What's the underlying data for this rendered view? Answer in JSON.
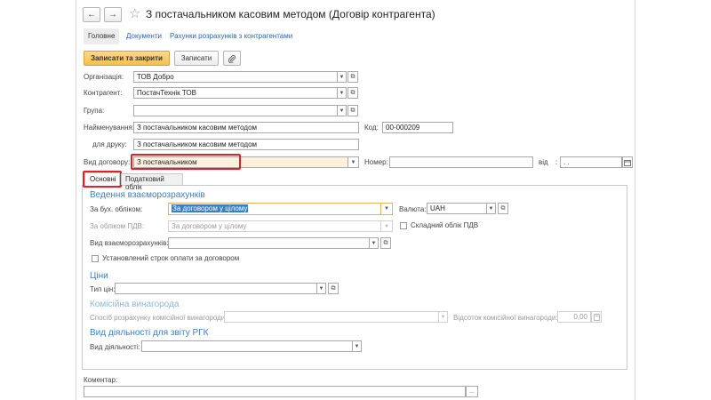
{
  "header": {
    "back": "←",
    "forward": "→",
    "star": "☆",
    "title": "З постачальником касовим методом (Договір контрагента)"
  },
  "nav_tabs": [
    "Головне",
    "Документи",
    "Рахунки розрахунків з контрагентами"
  ],
  "toolbar": {
    "save_close": "Записати та закрити",
    "save": "Записати"
  },
  "form": {
    "org_label": "Організація:",
    "org_value": "ТОВ Добро",
    "contractor_label": "Контрагент:",
    "contractor_value": "ПостачТехнік ТОВ",
    "group_label": "Група:",
    "group_value": "",
    "name_label": "Найменування:",
    "name_value": "З постачальником касовим методом",
    "code_label": "Код:",
    "code_value": "00-000209",
    "print_label": "для друку:",
    "print_value": "З постачальником касовим методом",
    "kind_label": "Вид договору:",
    "kind_value": "З постачальником",
    "number_label": "Номер:",
    "number_value": "",
    "date_label": "від",
    "date_value": ". .",
    "colon": ":"
  },
  "sub_tabs": [
    "Основні",
    "Податковий облік"
  ],
  "settlements": {
    "title": "Ведення взаєморозрахунків",
    "acc_label": "За бух. обліком:",
    "acc_value": "За договором у цілому",
    "currency_label": "Валюта:",
    "currency_value": "UAH",
    "vat_label": "За обліком ПДВ:",
    "vat_value": "За договором у цілому",
    "complex_vat": "Складний облік ПДВ",
    "kind_label": "Вид взаєморозрахунків:",
    "kind_value": "",
    "term_label": "Установлений строк оплати за договором"
  },
  "prices": {
    "title": "Ціни",
    "type_label": "Тип цін:",
    "type_value": ""
  },
  "commission": {
    "title": "Комісійна винагорода",
    "method_label": "Спосіб розрахунку комісійної винагороди:",
    "method_value": "",
    "percent_label": "Відсоток комісійної винагороди:",
    "percent_value": "0,00"
  },
  "activity": {
    "title": "Вид діяльності для звіту РГК",
    "kind_label": "Вид діяльності:",
    "kind_value": ""
  },
  "comment": {
    "label": "Коментар:",
    "value": "",
    "more": "..."
  },
  "icons": {
    "open": "open-form-icon",
    "attach": "paperclip-icon",
    "calendar": "calendar-icon",
    "calculator": "calculator-icon",
    "dropdown": "chevron-down-icon"
  },
  "colors": {
    "accent": "#3a7fc4",
    "highlight_border": "#e0202a",
    "primary_button": "#f4c04f",
    "kind_field_bg": "#fdf1dc"
  }
}
